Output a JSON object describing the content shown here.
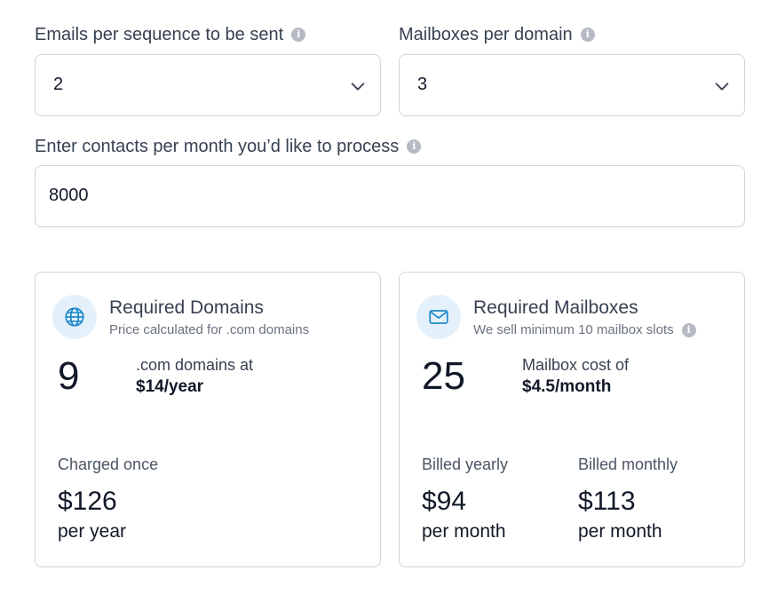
{
  "form": {
    "emails_per_sequence": {
      "label": "Emails per sequence to be sent",
      "value": "2"
    },
    "mailboxes_per_domain": {
      "label": "Mailboxes per domain",
      "value": "3"
    },
    "contacts_per_month": {
      "label": "Enter contacts per month you’d like to process",
      "value": "8000"
    },
    "info_glyph": "i"
  },
  "domains_card": {
    "icon": "globe-icon",
    "title": "Required Domains",
    "subtitle": "Price calculated for .com domains",
    "count": "9",
    "cost_label": ".com domains at",
    "cost_value": "$14/year",
    "billing": {
      "label": "Charged once",
      "amount": "$126",
      "period": "per year"
    }
  },
  "mailboxes_card": {
    "icon": "mail-icon",
    "title": "Required Mailboxes",
    "subtitle": "We sell minimum 10 mailbox slots",
    "count": "25",
    "cost_label": "Mailbox cost of",
    "cost_value": "$4.5/month",
    "billing_yearly": {
      "label": "Billed yearly",
      "amount": "$94",
      "period": "per month"
    },
    "billing_monthly": {
      "label": "Billed monthly",
      "amount": "$113",
      "period": "per month"
    }
  },
  "colors": {
    "icon_accent": "#1e88c8",
    "icon_bg": "#e4f1fb",
    "border": "#d1d5db",
    "info_icon": "#b6bac2"
  }
}
